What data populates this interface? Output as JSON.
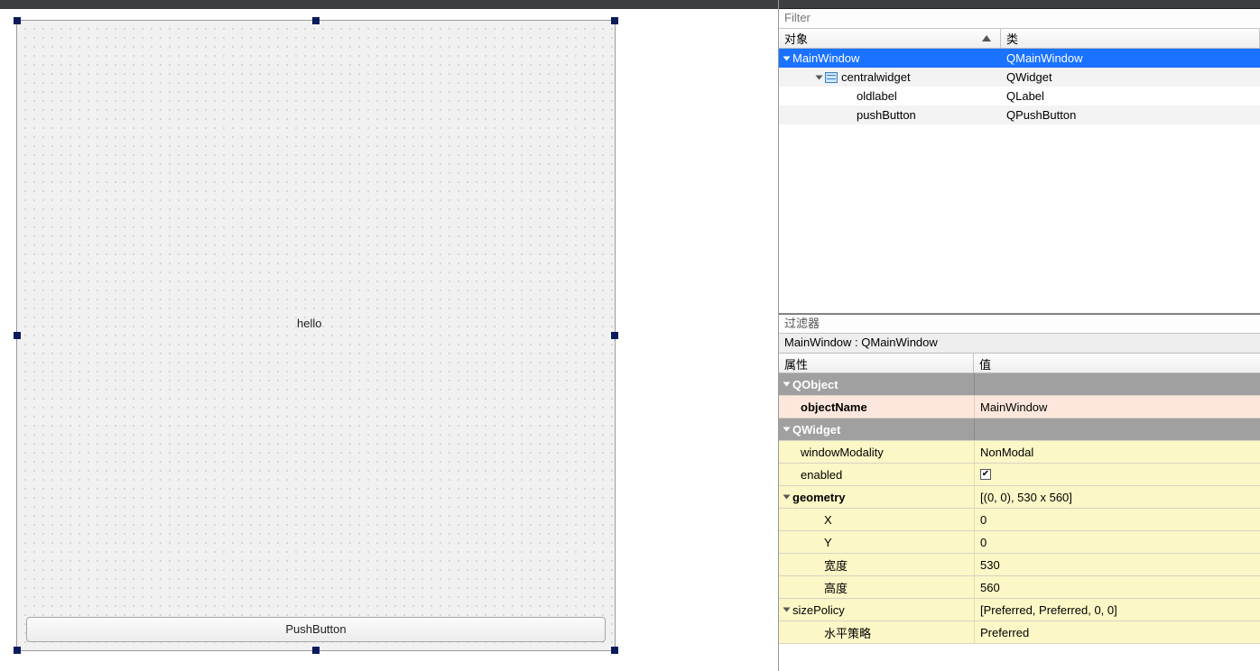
{
  "design": {
    "label_text": "hello",
    "button_text": "PushButton"
  },
  "filter_placeholder": "Filter",
  "tree_header": {
    "object": "对象",
    "class": "类"
  },
  "tree": [
    {
      "name": "MainWindow",
      "cls": "QMainWindow",
      "level": 0,
      "selected": true,
      "expandable": true
    },
    {
      "name": "centralwidget",
      "cls": "QWidget",
      "level": 1,
      "selected": false,
      "expandable": true,
      "icon": "layout"
    },
    {
      "name": "oldlabel",
      "cls": "QLabel",
      "level": 2,
      "selected": false,
      "expandable": false
    },
    {
      "name": "pushButton",
      "cls": "QPushButton",
      "level": 2,
      "selected": false,
      "expandable": false
    }
  ],
  "prop_filter_placeholder": "过滤器",
  "prop_title": "MainWindow : QMainWindow",
  "prop_header": {
    "name": "属性",
    "value": "值"
  },
  "props": {
    "sec1": "QObject",
    "objectName_k": "objectName",
    "objectName_v": "MainWindow",
    "sec2": "QWidget",
    "windowModality_k": "windowModality",
    "windowModality_v": "NonModal",
    "enabled_k": "enabled",
    "enabled_v": "✔",
    "geometry_k": "geometry",
    "geometry_v": "[(0, 0), 530 x 560]",
    "x_k": "X",
    "x_v": "0",
    "y_k": "Y",
    "y_v": "0",
    "w_k": "宽度",
    "w_v": "530",
    "h_k": "高度",
    "h_v": "560",
    "sizePolicy_k": "sizePolicy",
    "sizePolicy_v": "[Preferred, Preferred, 0, 0]",
    "hpolicy_k": "水平策略",
    "hpolicy_v": "Preferred"
  }
}
